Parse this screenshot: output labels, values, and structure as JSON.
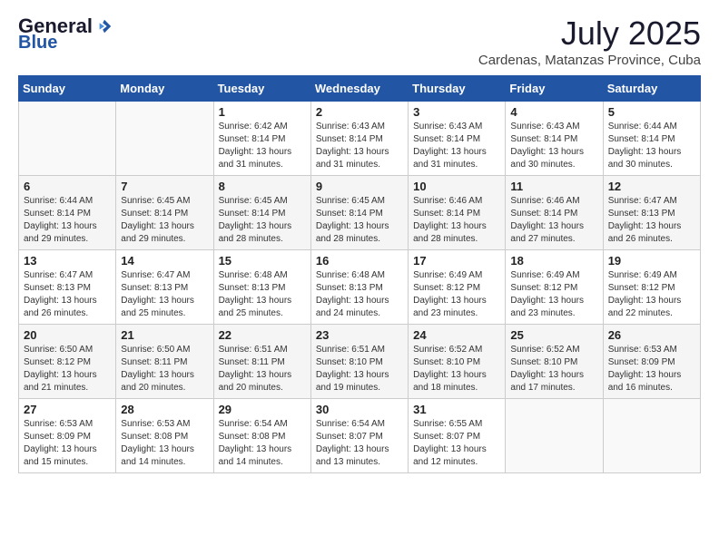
{
  "header": {
    "logo_general": "General",
    "logo_blue": "Blue",
    "month_year": "July 2025",
    "location": "Cardenas, Matanzas Province, Cuba"
  },
  "days_of_week": [
    "Sunday",
    "Monday",
    "Tuesday",
    "Wednesday",
    "Thursday",
    "Friday",
    "Saturday"
  ],
  "weeks": [
    [
      {
        "day": "",
        "info": ""
      },
      {
        "day": "",
        "info": ""
      },
      {
        "day": "1",
        "info": "Sunrise: 6:42 AM\nSunset: 8:14 PM\nDaylight: 13 hours and 31 minutes."
      },
      {
        "day": "2",
        "info": "Sunrise: 6:43 AM\nSunset: 8:14 PM\nDaylight: 13 hours and 31 minutes."
      },
      {
        "day": "3",
        "info": "Sunrise: 6:43 AM\nSunset: 8:14 PM\nDaylight: 13 hours and 31 minutes."
      },
      {
        "day": "4",
        "info": "Sunrise: 6:43 AM\nSunset: 8:14 PM\nDaylight: 13 hours and 30 minutes."
      },
      {
        "day": "5",
        "info": "Sunrise: 6:44 AM\nSunset: 8:14 PM\nDaylight: 13 hours and 30 minutes."
      }
    ],
    [
      {
        "day": "6",
        "info": "Sunrise: 6:44 AM\nSunset: 8:14 PM\nDaylight: 13 hours and 29 minutes."
      },
      {
        "day": "7",
        "info": "Sunrise: 6:45 AM\nSunset: 8:14 PM\nDaylight: 13 hours and 29 minutes."
      },
      {
        "day": "8",
        "info": "Sunrise: 6:45 AM\nSunset: 8:14 PM\nDaylight: 13 hours and 28 minutes."
      },
      {
        "day": "9",
        "info": "Sunrise: 6:45 AM\nSunset: 8:14 PM\nDaylight: 13 hours and 28 minutes."
      },
      {
        "day": "10",
        "info": "Sunrise: 6:46 AM\nSunset: 8:14 PM\nDaylight: 13 hours and 28 minutes."
      },
      {
        "day": "11",
        "info": "Sunrise: 6:46 AM\nSunset: 8:14 PM\nDaylight: 13 hours and 27 minutes."
      },
      {
        "day": "12",
        "info": "Sunrise: 6:47 AM\nSunset: 8:13 PM\nDaylight: 13 hours and 26 minutes."
      }
    ],
    [
      {
        "day": "13",
        "info": "Sunrise: 6:47 AM\nSunset: 8:13 PM\nDaylight: 13 hours and 26 minutes."
      },
      {
        "day": "14",
        "info": "Sunrise: 6:47 AM\nSunset: 8:13 PM\nDaylight: 13 hours and 25 minutes."
      },
      {
        "day": "15",
        "info": "Sunrise: 6:48 AM\nSunset: 8:13 PM\nDaylight: 13 hours and 25 minutes."
      },
      {
        "day": "16",
        "info": "Sunrise: 6:48 AM\nSunset: 8:13 PM\nDaylight: 13 hours and 24 minutes."
      },
      {
        "day": "17",
        "info": "Sunrise: 6:49 AM\nSunset: 8:12 PM\nDaylight: 13 hours and 23 minutes."
      },
      {
        "day": "18",
        "info": "Sunrise: 6:49 AM\nSunset: 8:12 PM\nDaylight: 13 hours and 23 minutes."
      },
      {
        "day": "19",
        "info": "Sunrise: 6:49 AM\nSunset: 8:12 PM\nDaylight: 13 hours and 22 minutes."
      }
    ],
    [
      {
        "day": "20",
        "info": "Sunrise: 6:50 AM\nSunset: 8:12 PM\nDaylight: 13 hours and 21 minutes."
      },
      {
        "day": "21",
        "info": "Sunrise: 6:50 AM\nSunset: 8:11 PM\nDaylight: 13 hours and 20 minutes."
      },
      {
        "day": "22",
        "info": "Sunrise: 6:51 AM\nSunset: 8:11 PM\nDaylight: 13 hours and 20 minutes."
      },
      {
        "day": "23",
        "info": "Sunrise: 6:51 AM\nSunset: 8:10 PM\nDaylight: 13 hours and 19 minutes."
      },
      {
        "day": "24",
        "info": "Sunrise: 6:52 AM\nSunset: 8:10 PM\nDaylight: 13 hours and 18 minutes."
      },
      {
        "day": "25",
        "info": "Sunrise: 6:52 AM\nSunset: 8:10 PM\nDaylight: 13 hours and 17 minutes."
      },
      {
        "day": "26",
        "info": "Sunrise: 6:53 AM\nSunset: 8:09 PM\nDaylight: 13 hours and 16 minutes."
      }
    ],
    [
      {
        "day": "27",
        "info": "Sunrise: 6:53 AM\nSunset: 8:09 PM\nDaylight: 13 hours and 15 minutes."
      },
      {
        "day": "28",
        "info": "Sunrise: 6:53 AM\nSunset: 8:08 PM\nDaylight: 13 hours and 14 minutes."
      },
      {
        "day": "29",
        "info": "Sunrise: 6:54 AM\nSunset: 8:08 PM\nDaylight: 13 hours and 14 minutes."
      },
      {
        "day": "30",
        "info": "Sunrise: 6:54 AM\nSunset: 8:07 PM\nDaylight: 13 hours and 13 minutes."
      },
      {
        "day": "31",
        "info": "Sunrise: 6:55 AM\nSunset: 8:07 PM\nDaylight: 13 hours and 12 minutes."
      },
      {
        "day": "",
        "info": ""
      },
      {
        "day": "",
        "info": ""
      }
    ]
  ]
}
